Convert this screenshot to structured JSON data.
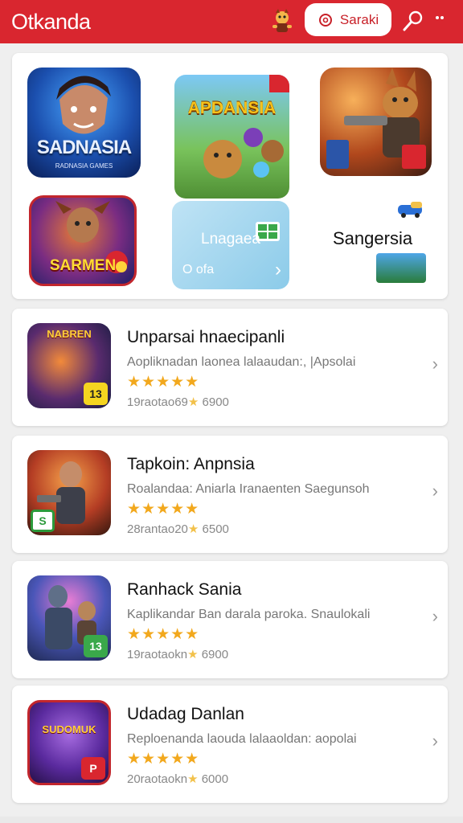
{
  "header": {
    "title": "Otkanda",
    "search_label": "Saraki",
    "colors": {
      "bar": "#d9262f",
      "accent": "#c82028"
    },
    "icons": [
      "mascot-icon",
      "search-icon",
      "settings-icon",
      "more-icon"
    ]
  },
  "featured": {
    "tiles": [
      {
        "label": "SADNASIA",
        "sub": "RADNASIA GAMES"
      },
      {
        "label": "APDANSIA"
      },
      {
        "label": ""
      },
      {
        "label": "SARMEN"
      },
      {
        "label": "Lnagaea",
        "small": "O ofa"
      },
      {
        "label": "Sangersia"
      }
    ]
  },
  "apps": [
    {
      "title": "Unparsai hnaecipanli",
      "desc": "Aopliknadan laonea lalaaudan:, |Apsolai",
      "stars": "★★★★★",
      "meta_left": "19raotao69",
      "meta_right": "6900",
      "badge": "13"
    },
    {
      "title": "Tapkoin: Anpnsia",
      "desc": "Roalandaa: Aniarla Iranaenten Saegunsoh",
      "stars": "★★★★★",
      "meta_left": "28rantao20",
      "meta_right": "6500",
      "badge": "S"
    },
    {
      "title": "Ranhack Sania",
      "desc": "Kaplikandar Ban darala paroka. Snaulokali",
      "stars": "★★★★★",
      "meta_left": "19raotaokn",
      "meta_right": "6900",
      "badge": "13"
    },
    {
      "title": "Udadag Danlan",
      "desc": "Reploenanda laouda lalaaoldan: aopolai",
      "stars": "★★★★★",
      "meta_left": "20raotaokn",
      "meta_right": "6000",
      "badge": "P"
    }
  ]
}
